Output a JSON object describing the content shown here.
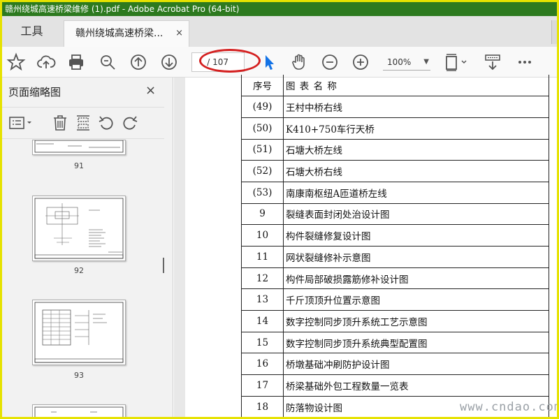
{
  "window": {
    "title": "赣州绕城高速桥梁维修 (1).pdf - Adobe Acrobat Pro (64-bit)"
  },
  "tabs": {
    "tools": "工具",
    "document": "赣州绕城高速桥梁...",
    "close": "×"
  },
  "toolbar": {
    "page_total": "/ 107",
    "zoom": "100%"
  },
  "sidebar": {
    "title": "页面缩略图",
    "close": "×",
    "thumbnails": [
      {
        "label": "91"
      },
      {
        "label": "92"
      },
      {
        "label": "93"
      }
    ]
  },
  "document": {
    "header": {
      "num": "序号",
      "name": "图 表 名 称"
    },
    "rows": [
      {
        "num": "(49)",
        "name": "王村中桥右线"
      },
      {
        "num": "(50)",
        "name": "K410+750车行天桥"
      },
      {
        "num": "(51)",
        "name": "石塘大桥左线"
      },
      {
        "num": "(52)",
        "name": "石塘大桥右线"
      },
      {
        "num": "(53)",
        "name": "南康南枢纽A匝道桥左线"
      },
      {
        "num": "9",
        "name": "裂缝表面封闭处治设计图"
      },
      {
        "num": "10",
        "name": "构件裂缝修复设计图"
      },
      {
        "num": "11",
        "name": "网状裂缝修补示意图"
      },
      {
        "num": "12",
        "name": "构件局部破损露筋修补设计图"
      },
      {
        "num": "13",
        "name": "千斤顶顶升位置示意图"
      },
      {
        "num": "14",
        "name": "数字控制同步顶升系统工艺示意图"
      },
      {
        "num": "15",
        "name": "数字控制同步顶升系统典型配置图"
      },
      {
        "num": "16",
        "name": "桥墩基础冲刷防护设计图"
      },
      {
        "num": "17",
        "name": "桥梁基础外包工程数量一览表"
      },
      {
        "num": "18",
        "name": "防落物设计图"
      }
    ]
  },
  "watermark": "www.cndao.com",
  "colors": {
    "titlebar": "#2d7a1f",
    "frame": "#e6e200",
    "annotation": "#d42020",
    "cursor": "#1473e6"
  }
}
